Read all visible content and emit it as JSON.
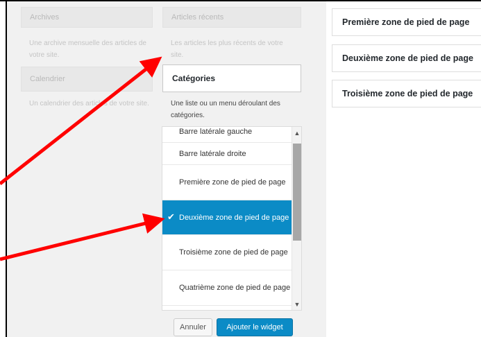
{
  "widgets": {
    "archives": {
      "title": "Archives",
      "description": "Une archive mensuelle des articles de votre site."
    },
    "recent_posts": {
      "title": "Articles récents",
      "description": "Les articles les plus récents de votre site."
    },
    "calendar": {
      "title": "Calendrier",
      "description": "Un calendrier des articles de votre site."
    },
    "categories": {
      "title": "Catégories",
      "description": "Une liste ou un menu déroulant des catégories."
    }
  },
  "sidebar_chooser": {
    "items": [
      {
        "label": "Barre latérale gauche"
      },
      {
        "label": "Barre latérale droite"
      },
      {
        "label": "Première zone de pied de page"
      },
      {
        "label": "Deuxième zone de pied de page",
        "selected": true
      },
      {
        "label": "Troisième zone de pied de page"
      },
      {
        "label": "Quatrième zone de pied de page"
      }
    ],
    "scroll_up_icon": "▲",
    "scroll_down_icon": "▼",
    "check_icon": "✔"
  },
  "actions": {
    "cancel_label": "Annuler",
    "add_label": "Ajouter le widget"
  },
  "footer_zones": [
    {
      "label": "Première zone de pied de page"
    },
    {
      "label": "Deuxième zone de pied de page"
    },
    {
      "label": "Troisième zone de pied de page"
    }
  ],
  "colors": {
    "accent": "#0b8bc6",
    "arrow": "#ff0000"
  }
}
